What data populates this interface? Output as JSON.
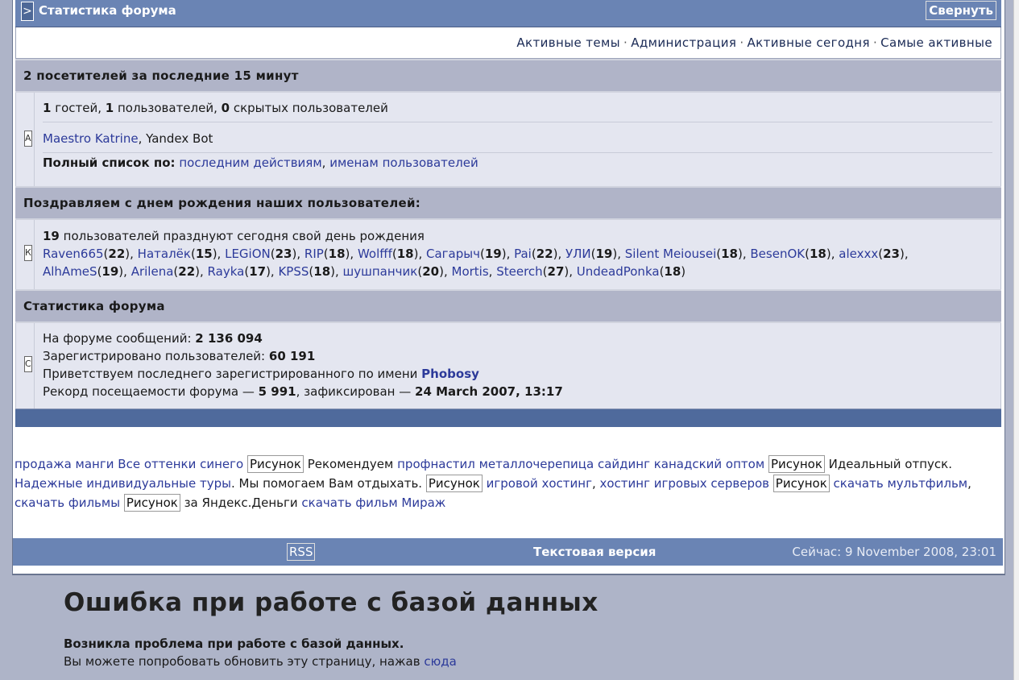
{
  "titlebar": {
    "toggle": ">",
    "title": "Статистика форума",
    "collapse": "Свернуть"
  },
  "nav": {
    "links": [
      "Активные темы",
      "Администрация",
      "Активные сегодня",
      "Самые активные"
    ],
    "sep": "·"
  },
  "visitors": {
    "header": "2 посетителей за последние 15 минут",
    "icon": "A",
    "guests": "1",
    "guests_label": " гостей, ",
    "users": "1",
    "users_label": " пользователей, ",
    "hidden": "0",
    "hidden_label": " скрытых пользователей",
    "online": [
      "Maestro Katrine",
      "Yandex Bot"
    ],
    "fulllist_label": "Полный список по:",
    "fulllist_links": [
      "последним действиям",
      "именам пользователей"
    ]
  },
  "birthdays": {
    "header": "Поздравляем с днем рождения наших пользователей:",
    "icon": "К",
    "count": "19",
    "count_label": " пользователей празднуют сегодня свой день рождения",
    "line1": [
      {
        "name": "Raven665",
        "age": "22"
      },
      {
        "name": "Наталёк",
        "age": "15"
      },
      {
        "name": "LEGiON",
        "age": "23"
      },
      {
        "name": "RIP",
        "age": "18"
      },
      {
        "name": "Wolfff",
        "age": "18"
      },
      {
        "name": "Сагарыч",
        "age": "19"
      },
      {
        "name": "Pai",
        "age": "22"
      },
      {
        "name": "УЛИ",
        "age": "19"
      },
      {
        "name": "Silent Meiousei",
        "age": "18"
      },
      {
        "name": "BesenOK",
        "age": "18"
      },
      {
        "name": "alexxx",
        "age": "23"
      }
    ],
    "line2": [
      {
        "name": "AlhAmeS",
        "age": "19"
      },
      {
        "name": "Arilena",
        "age": "22"
      },
      {
        "name": "Rayka",
        "age": "17"
      },
      {
        "name": "KPSS",
        "age": "18"
      },
      {
        "name": "шушпанчик",
        "age": "20"
      },
      {
        "name": "Mortis",
        "age": ""
      },
      {
        "name": "Steerch",
        "age": "27"
      },
      {
        "name": "UndeadPonka",
        "age": "18"
      }
    ]
  },
  "stats": {
    "header": "Статистика форума",
    "icon": "С",
    "posts_label": "На форуме сообщений: ",
    "posts": "2 136 094",
    "registered_label": "Зарегистрировано пользователей: ",
    "registered": "60 191",
    "welcome_label": "Приветствуем последнего зарегистрированного по имени ",
    "newest": "Phobosy",
    "record_label": "Рекорд посещаемости форума — ",
    "record": "5 991",
    "record_mid": ", зафиксирован — ",
    "record_date": "24 March 2007, 13:17"
  },
  "ads": {
    "a1": "продажа манги",
    "a2": "Все оттенки синего",
    "img": "Рисунок",
    "t1": " Рекомендуем ",
    "a3": "профнастил",
    "a4": "металлочерепица",
    "a5": "сайдинг канадский оптом",
    "t2": " Идеальный отпуск.",
    "a6": "Надежные индивидуальные туры",
    "t3": ". Мы помогаем Вам отдыхать.",
    "a7": "игровой хостинг",
    "a8": "хостинг игровых серверов",
    "a9": "скачать мультфильм",
    "a10": "скачать фильмы",
    "t4": " за Яндекс.Деньги ",
    "a11": "скачать фильм Мираж"
  },
  "footer": {
    "rss": "RSS",
    "textver": "Текстовая версия",
    "now": "Сейчас: 9 November 2008, 23:01"
  },
  "error": {
    "title": "Ошибка при работе с базой данных",
    "line1": "Возникла проблема при работе с базой данных.",
    "line2": "Вы можете попробовать обновить эту страницу, нажав ",
    "link": "сюда"
  }
}
